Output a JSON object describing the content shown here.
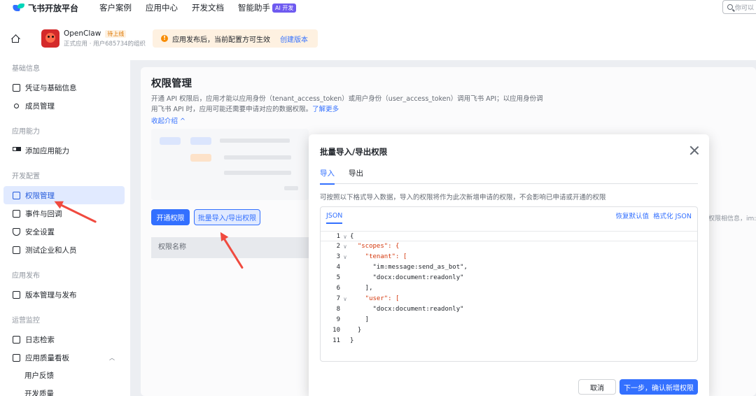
{
  "brand": {
    "name": "飞书开放平台"
  },
  "nav": {
    "links": [
      "客户案例",
      "应用中心",
      "开发文档",
      "智能助手"
    ],
    "ai_badge": "AI 开发",
    "search_placeholder": "你可以"
  },
  "app": {
    "name": "OpenClaw",
    "status": "待上线",
    "subtitle": "正式应用 · 用户685734的组织",
    "notice": "应用发布后，当前配置方可生效",
    "notice_link": "创建版本"
  },
  "sidebar": {
    "groups": [
      {
        "title": "基础信息",
        "items": [
          "凭证与基础信息",
          "成员管理"
        ]
      },
      {
        "title": "应用能力",
        "items": [
          "添加应用能力"
        ]
      },
      {
        "title": "开发配置",
        "items": [
          "权限管理",
          "事件与回调",
          "安全设置",
          "测试企业和人员"
        ]
      },
      {
        "title": "应用发布",
        "items": [
          "版本管理与发布"
        ]
      },
      {
        "title": "运营监控",
        "items": [
          "日志检索",
          "应用质量看板"
        ],
        "subitems": [
          "用户反馈",
          "开发质量"
        ]
      }
    ],
    "active": "权限管理"
  },
  "page": {
    "title": "权限管理",
    "desc": "开通 API 权限后，应用才能以应用身份（tenant_access_token）或用户身份（user_access_token）调用飞书 API；以应用身份调用飞书 API 时，应用可能还需要申请对应的数据权限。",
    "desc_link": "了解更多",
    "collapse": "收起介绍",
    "btn_open": "开通权限",
    "btn_batch": "批量导入/导出权限",
    "table_col": "权限名称",
    "right_hint": "权限相信息，im:"
  },
  "modal": {
    "title": "批量导入/导出权限",
    "tabs": [
      "导入",
      "导出"
    ],
    "active_tab": "导入",
    "hint": "可按照以下格式导入数据，导入的权限将作为此次新增申请的权限，不会影响已申请或开通的权限",
    "editor_tab": "JSON",
    "action_reset": "恢复默认值",
    "action_format": "格式化 JSON",
    "code_lines": [
      {
        "n": "1",
        "fold": "∨",
        "text": "{"
      },
      {
        "n": "2",
        "fold": "∨",
        "text": "  \"scopes\": {"
      },
      {
        "n": "3",
        "fold": "∨",
        "text": "    \"tenant\": ["
      },
      {
        "n": "4",
        "fold": "",
        "text": "      \"im:message:send_as_bot\","
      },
      {
        "n": "5",
        "fold": "",
        "text": "      \"docx:document:readonly\""
      },
      {
        "n": "6",
        "fold": "",
        "text": "    ],"
      },
      {
        "n": "7",
        "fold": "∨",
        "text": "    \"user\": ["
      },
      {
        "n": "8",
        "fold": "",
        "text": "      \"docx:document:readonly\""
      },
      {
        "n": "9",
        "fold": "",
        "text": "    ]"
      },
      {
        "n": "10",
        "fold": "",
        "text": "  }"
      },
      {
        "n": "11",
        "fold": "",
        "text": "}"
      }
    ],
    "btn_cancel": "取消",
    "btn_next": "下一步，确认新增权限"
  },
  "colors": {
    "accent": "#3370ff",
    "active_bg": "#e1eaff",
    "arrow": "#f04a3f",
    "notice_bg": "#fef1e1"
  }
}
